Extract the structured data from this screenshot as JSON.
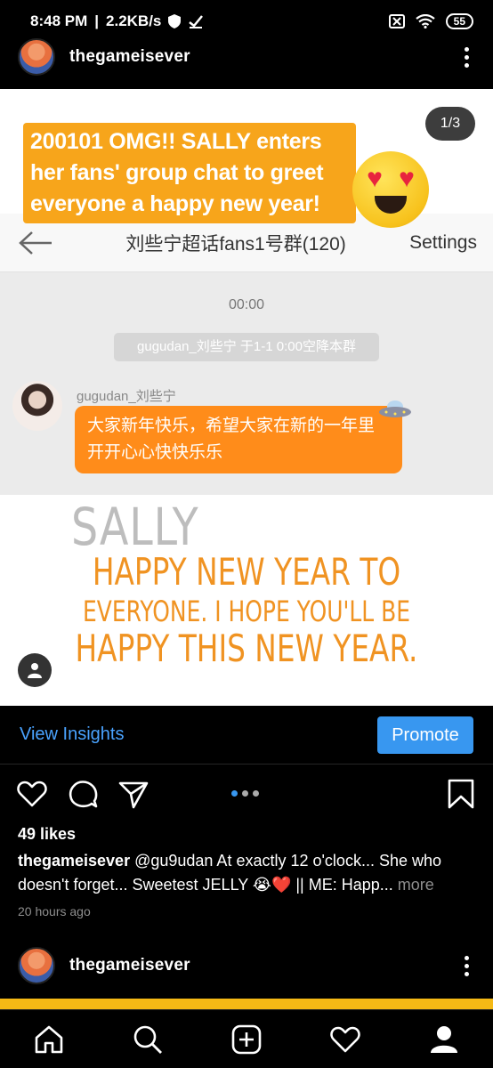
{
  "status_bar": {
    "time": "8:48 PM",
    "network_speed": "2.2KB/s",
    "battery": "55"
  },
  "post": {
    "username": "thegameisever",
    "image": {
      "page_counter": "1/3",
      "caption_overlay": "200101 OMG!! SALLY enters her fans' group chat to greet everyone a happy new year!",
      "chat": {
        "title": "刘些宁超话fans1号群(120)",
        "settings": "Settings",
        "time": "00:00",
        "system_note": "gugudan_刘些宁 于1-1 0:00空降本群",
        "sender": "gugudan_刘些宁",
        "message": "大家新年快乐，希望大家在新的一年里开开心心快快乐乐"
      },
      "translation": {
        "name": "SALLY",
        "line1": "HAPPY NEW YEAR TO",
        "line2": "EVERYONE.  I HOPE YOU'LL BE",
        "line3": "HAPPY THIS NEW YEAR."
      }
    },
    "view_insights": "View Insights",
    "promote": "Promote",
    "likes": "49 likes",
    "caption_user": "thegameisever",
    "caption_text": " @gu9udan At exactly 12 o'clock... She who doesn't forget... Sweetest JELLY 😭❤️ || ME: Happ...",
    "caption_more": " more",
    "timestamp": "20 hours ago",
    "carousel": {
      "count": 3,
      "active": 0
    }
  },
  "next_post": {
    "username": "thegameisever"
  },
  "colors": {
    "accent_blue": "#3897f0",
    "caption_orange": "#f7a51b",
    "bubble_orange": "#ff8c1a"
  },
  "icons": [
    "heart-icon",
    "comment-icon",
    "share-icon",
    "bookmark-icon",
    "home-icon",
    "search-icon",
    "add-icon",
    "activity-icon",
    "profile-icon"
  ]
}
